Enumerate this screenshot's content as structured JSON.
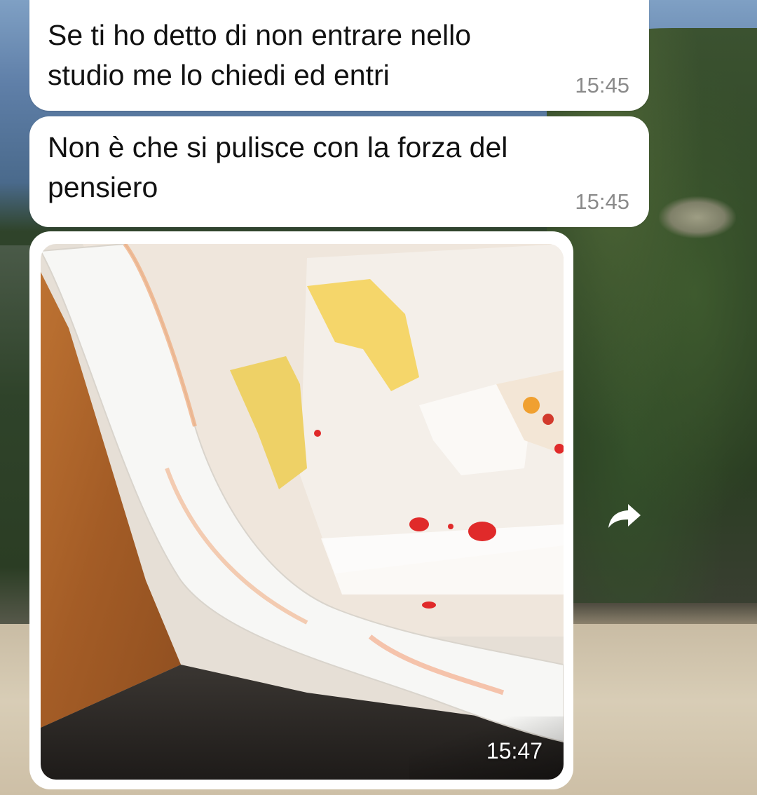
{
  "messages": [
    {
      "text": "Se ti ho detto di non entrare nello\nstudio me lo chiedi ed entri",
      "time": "15:45"
    },
    {
      "text": "Non è che si pulisce con la forza del\npensiero",
      "time": "15:45"
    },
    {
      "type": "image",
      "time": "15:47"
    }
  ],
  "icons": {
    "forward": "forward-arrow-icon"
  },
  "colors": {
    "bubble": "#ffffff",
    "text": "#111111",
    "timestamp": "#8a8a8a"
  }
}
